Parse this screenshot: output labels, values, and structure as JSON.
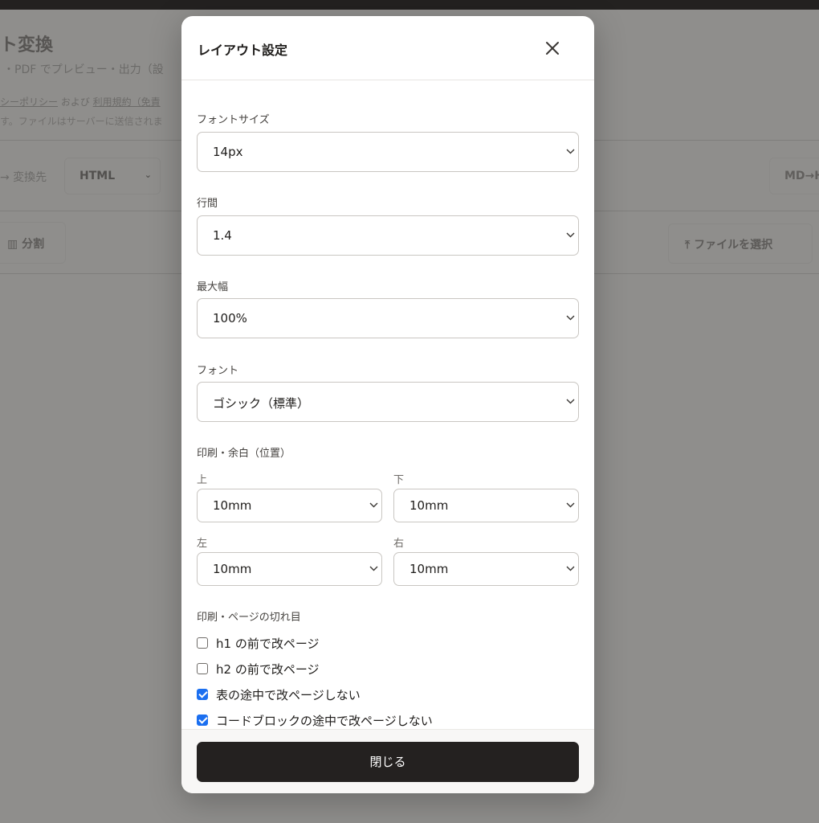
{
  "background": {
    "title": "ト変換",
    "subtitle": "・PDF でプレビュー・出力（設",
    "links_prefix": "シーポリシー",
    "links_mid": " および ",
    "links_second": "利用規約（免責",
    "note": "す。ファイルはサーバーに送信されま",
    "convert_label": "→ 変換先",
    "convert_select": "HTML",
    "md_button": "MD→H",
    "split_button": "分割",
    "file_button": "ファイルを選択"
  },
  "modal": {
    "title": "レイアウト設定",
    "font_size": {
      "label": "フォントサイズ",
      "value": "14px"
    },
    "line_height": {
      "label": "行間",
      "value": "1.4"
    },
    "max_width": {
      "label": "最大幅",
      "value": "100%"
    },
    "font": {
      "label": "フォント",
      "value": "ゴシック（標準）"
    },
    "margins": {
      "label": "印刷・余白（位置）",
      "top": {
        "label": "上",
        "value": "10mm"
      },
      "bottom": {
        "label": "下",
        "value": "10mm"
      },
      "left": {
        "label": "左",
        "value": "10mm"
      },
      "right": {
        "label": "右",
        "value": "10mm"
      }
    },
    "page_breaks": {
      "label": "印刷・ページの切れ目",
      "options": [
        {
          "label": "h1 の前で改ページ",
          "checked": false
        },
        {
          "label": "h2 の前で改ページ",
          "checked": false
        },
        {
          "label": "表の途中で改ページしない",
          "checked": true
        },
        {
          "label": "コードブロックの途中で改ページしない",
          "checked": true
        }
      ]
    },
    "close_button": "閉じる"
  },
  "colors": {
    "checkbox_checked": "#1b6ff0",
    "primary_button": "#242120",
    "overlay": "#8f8e8c"
  }
}
